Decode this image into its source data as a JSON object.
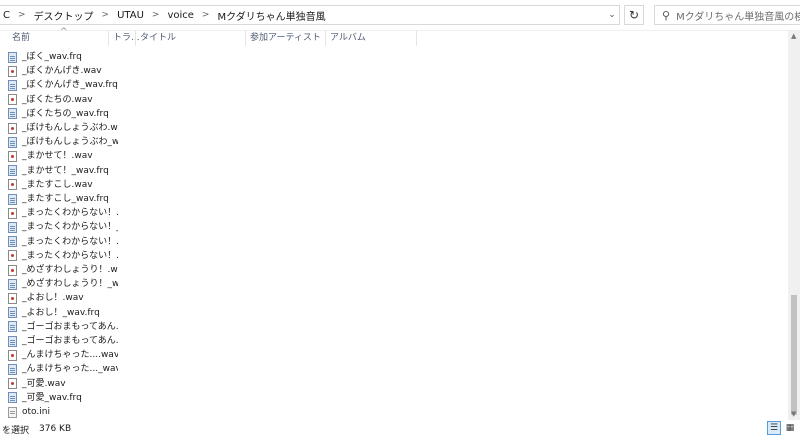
{
  "address": {
    "drive_fragment": "C",
    "crumbs": [
      "デスクトップ",
      "UTAU",
      "voice",
      "Mクダリちゃん単独音風"
    ],
    "separator": ">",
    "dropdown_glyph": "⌄",
    "refresh_glyph": "↻"
  },
  "search": {
    "placeholder": "Mクダリちゃん単独音風の検索",
    "icon": "search-icon"
  },
  "columns": {
    "name": "名前",
    "track": "トラ...",
    "title": "タイトル",
    "artist": "参加アーティスト",
    "album": "アルバム",
    "sort_glyph": "^"
  },
  "files": [
    {
      "name": "_ぼく_wav.frq",
      "type": "frq"
    },
    {
      "name": "_ぼくかんげき.wav",
      "type": "wav"
    },
    {
      "name": "_ぼくかんげき_wav.frq",
      "type": "frq"
    },
    {
      "name": "_ぼくたちの.wav",
      "type": "wav"
    },
    {
      "name": "_ぼくたちの_wav.frq",
      "type": "frq"
    },
    {
      "name": "_ぼけもんしょうぶわ.wav",
      "type": "wav"
    },
    {
      "name": "_ぼけもんしょうぶわ_w...",
      "type": "frq"
    },
    {
      "name": "_まかせて！.wav",
      "type": "wav"
    },
    {
      "name": "_まかせて！_wav.frq",
      "type": "frq"
    },
    {
      "name": "_またすこし.wav",
      "type": "wav"
    },
    {
      "name": "_またすこし_wav.frq",
      "type": "frq"
    },
    {
      "name": "_まったくわからない！...",
      "type": "wav"
    },
    {
      "name": "_まったくわからない！_...",
      "type": "frq"
    },
    {
      "name": "_まったくわからない！...",
      "type": "frq"
    },
    {
      "name": "_まったくわからない！...",
      "type": "wav"
    },
    {
      "name": "_めざすわしょうり！.wav",
      "type": "wav"
    },
    {
      "name": "_めざすわしょうり！_w...",
      "type": "frq"
    },
    {
      "name": "_よおし！.wav",
      "type": "wav"
    },
    {
      "name": "_よおし！_wav.frq",
      "type": "frq"
    },
    {
      "name": "_ゴーゴおまもってあん...",
      "type": "frq"
    },
    {
      "name": "_ゴーゴおまもってあん...",
      "type": "frq"
    },
    {
      "name": "_んまけちゃった....wav",
      "type": "wav"
    },
    {
      "name": "_んまけちゃった..._wav....",
      "type": "frq"
    },
    {
      "name": "_可愛.wav",
      "type": "wav"
    },
    {
      "name": "_可愛_wav.frq",
      "type": "frq"
    },
    {
      "name": "oto.ini",
      "type": "ini"
    }
  ],
  "status": {
    "selection": "を選択",
    "size": "376 KB"
  },
  "view_buttons": {
    "details_icon": "details-view-icon",
    "tiles_icon": "large-icons-view-icon"
  }
}
